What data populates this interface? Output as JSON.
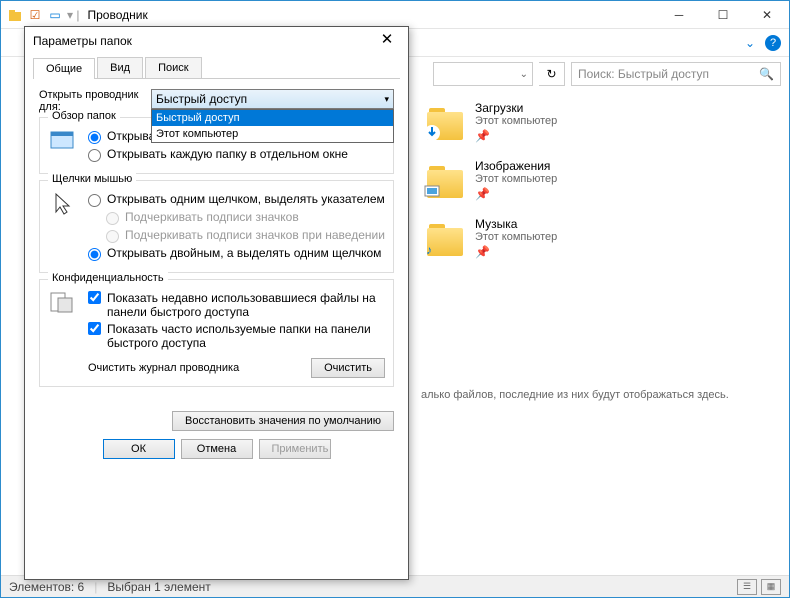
{
  "window": {
    "title": "Проводник"
  },
  "search": {
    "placeholder": "Поиск: Быстрый доступ"
  },
  "folders": [
    {
      "name": "Загрузки",
      "sub": "Этот компьютер",
      "badge": "↓"
    },
    {
      "name": "Изображения",
      "sub": "Этот компьютер",
      "badge": "img"
    },
    {
      "name": "Музыка",
      "sub": "Этот компьютер",
      "badge": "♪"
    }
  ],
  "hint": "алько файлов, последние из них будут отображаться здесь.",
  "status": {
    "items": "Элементов: 6",
    "selected": "Выбран 1 элемент"
  },
  "dialog": {
    "title": "Параметры папок",
    "tabs": {
      "general": "Общие",
      "view": "Вид",
      "search": "Поиск"
    },
    "open_label": "Открыть проводник для:",
    "combo_value": "Быстрый доступ",
    "combo_options": {
      "opt1": "Быстрый доступ",
      "opt2": "Этот компьютер"
    },
    "browse": {
      "legend": "Обзор папок",
      "same": "Открывать папки в одном и том же окне",
      "new": "Открывать каждую папку в отдельном окне"
    },
    "clicks": {
      "legend": "Щелчки мышью",
      "single": "Открывать одним щелчком, выделять указателем",
      "underline1": "Подчеркивать подписи значков",
      "underline2": "Подчеркивать подписи значков при наведении",
      "double": "Открывать двойным, а выделять одним щелчком"
    },
    "privacy": {
      "legend": "Конфиденциальность",
      "recent": "Показать недавно использовавшиеся файлы на панели быстрого доступа",
      "freq": "Показать часто используемые папки на панели быстрого доступа",
      "clear_label": "Очистить журнал проводника",
      "clear_btn": "Очистить"
    },
    "restore": "Восстановить значения по умолчанию",
    "ok": "ОК",
    "cancel": "Отмена",
    "apply": "Применить"
  }
}
